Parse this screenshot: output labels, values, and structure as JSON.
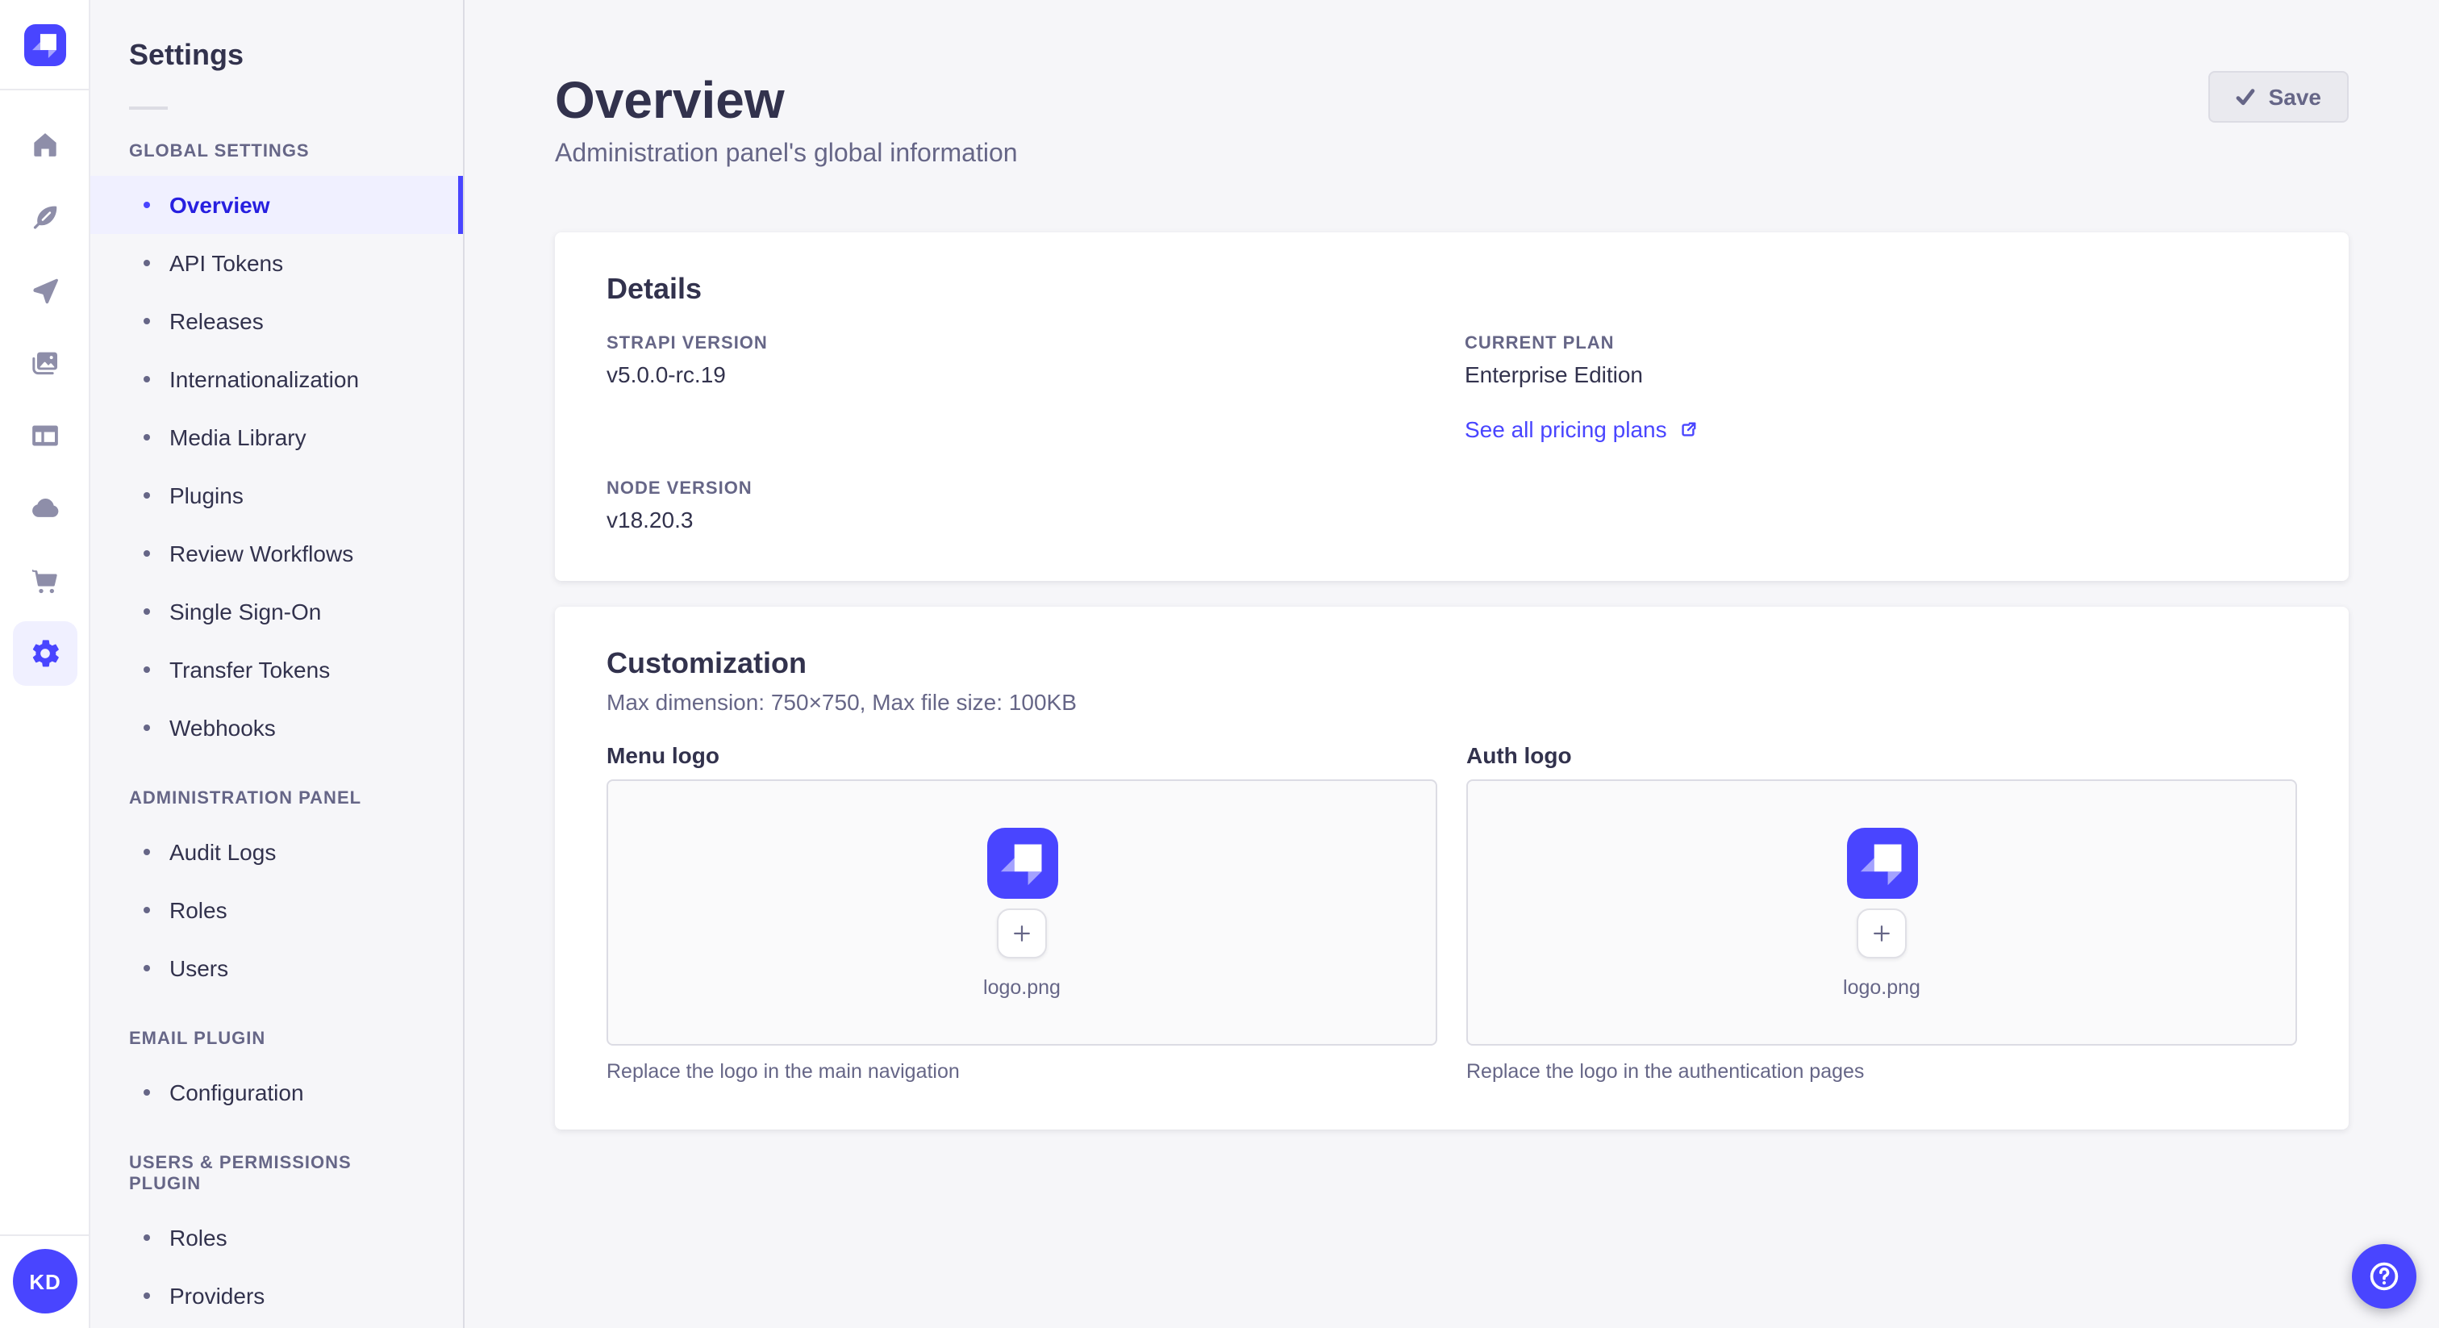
{
  "colors": {
    "primary": "#4945FF",
    "active_text": "#271FE0",
    "active_bg": "#F0F0FF",
    "page_bg": "#F6F6F9",
    "card_bg": "#FFFFFF",
    "text": "#32324D",
    "text_muted": "#666687",
    "rail_icon": "#8E8EA9",
    "border": "#EAEAEF",
    "disabled_button_bg": "#EAEAEF"
  },
  "rail": {
    "logo_icon": "strapi-logo",
    "items": [
      {
        "icon": "home-icon"
      },
      {
        "icon": "feather-icon"
      },
      {
        "icon": "paper-plane-icon"
      },
      {
        "icon": "media-library-icon"
      },
      {
        "icon": "layout-icon"
      },
      {
        "icon": "cloud-icon"
      },
      {
        "icon": "cart-icon"
      },
      {
        "icon": "gear-icon",
        "active": true
      }
    ],
    "avatar_initials": "KD",
    "help_icon": "question-mark-icon"
  },
  "subnav": {
    "title": "Settings",
    "sections": [
      {
        "label": "GLOBAL SETTINGS",
        "items": [
          {
            "label": "Overview",
            "active": true
          },
          {
            "label": "API Tokens"
          },
          {
            "label": "Releases"
          },
          {
            "label": "Internationalization"
          },
          {
            "label": "Media Library"
          },
          {
            "label": "Plugins"
          },
          {
            "label": "Review Workflows"
          },
          {
            "label": "Single Sign-On"
          },
          {
            "label": "Transfer Tokens"
          },
          {
            "label": "Webhooks"
          }
        ]
      },
      {
        "label": "ADMINISTRATION PANEL",
        "items": [
          {
            "label": "Audit Logs"
          },
          {
            "label": "Roles"
          },
          {
            "label": "Users"
          }
        ]
      },
      {
        "label": "EMAIL PLUGIN",
        "items": [
          {
            "label": "Configuration"
          }
        ]
      },
      {
        "label": "USERS & PERMISSIONS PLUGIN",
        "items": [
          {
            "label": "Roles"
          },
          {
            "label": "Providers"
          }
        ]
      }
    ]
  },
  "header": {
    "title": "Overview",
    "subtitle": "Administration panel's global information",
    "save_label": "Save"
  },
  "details_card": {
    "title": "Details",
    "strapi_version": {
      "label": "STRAPI VERSION",
      "value": "v5.0.0-rc.19"
    },
    "current_plan": {
      "label": "CURRENT PLAN",
      "value": "Enterprise Edition",
      "link_label": "See all pricing plans"
    },
    "node_version": {
      "label": "NODE VERSION",
      "value": "v18.20.3"
    }
  },
  "customization_card": {
    "title": "Customization",
    "subtitle": "Max dimension: 750×750, Max file size: 100KB",
    "menu_logo": {
      "label": "Menu logo",
      "filename": "logo.png",
      "caption": "Replace the logo in the main navigation"
    },
    "auth_logo": {
      "label": "Auth logo",
      "filename": "logo.png",
      "caption": "Replace the logo in the authentication pages"
    }
  }
}
